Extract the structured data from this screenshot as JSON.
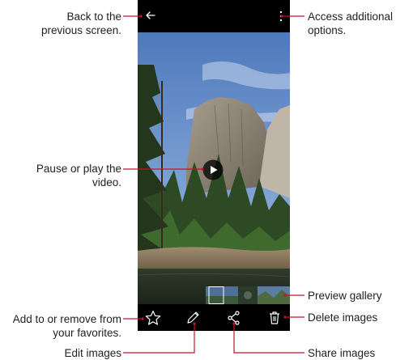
{
  "callouts": {
    "back": [
      "Back to the",
      "previous screen."
    ],
    "options": [
      "Access additional",
      "options."
    ],
    "play": [
      "Pause or play the",
      "video."
    ],
    "gallery": [
      "Preview gallery"
    ],
    "favorites": [
      "Add to or remove from",
      "your favorites."
    ],
    "delete": [
      "Delete images"
    ],
    "edit": [
      "Edit images"
    ],
    "share": [
      "Share images"
    ]
  },
  "icons": {
    "back": "arrow-left-icon",
    "options": "more-vertical-icon",
    "play": "play-icon",
    "favorite": "star-icon",
    "edit": "pencil-icon",
    "share": "share-icon",
    "delete": "trash-icon"
  },
  "colors": {
    "screen_bg": "#000000",
    "callout_line": "#c8102e",
    "sky": "#5d86c4"
  }
}
